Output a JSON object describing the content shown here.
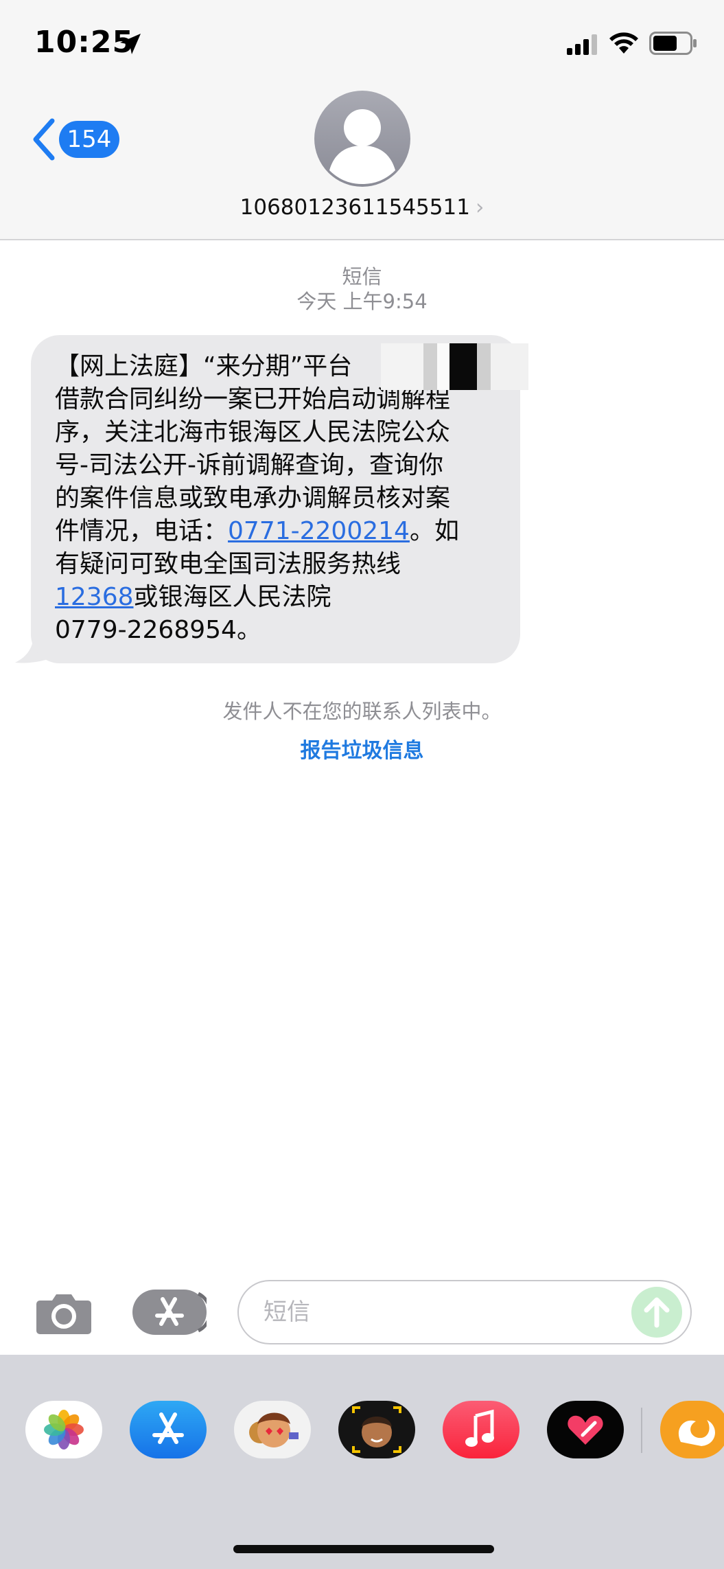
{
  "status_bar": {
    "time": "10:25",
    "location_icon": "location-arrow-icon",
    "signal_icon": "cellular-signal-icon",
    "wifi_icon": "wifi-icon",
    "battery_icon": "battery-icon"
  },
  "header": {
    "back_icon": "chevron-left-icon",
    "unread_count": "154",
    "avatar_icon": "person-icon",
    "contact_number": "10680123611545511",
    "contact_chevron": "›"
  },
  "conversation": {
    "service_label": "短信",
    "timestamp": "今天 上午9:54",
    "message": {
      "line1": "【网上法庭】“来分期”平台",
      "line2": "借款合同纠纷一案已开始启动调解程",
      "line3": "序，关注北海市银海区人民法院公众",
      "line4": "号-司法公开-诉前调解查询，查询你",
      "line5": "的案件信息或致电承办调解员核对案",
      "line6_prefix": "件情况，电话：",
      "phone_link": "0771-2200214",
      "line6_suffix": "。如",
      "line7": "有疑问可致电全国司法服务热线",
      "hotline_link": "12368",
      "line8_suffix": "或银海区人民法院",
      "line9": "0779-2268954。"
    },
    "not_in_contacts": "发件人不在您的联系人列表中。",
    "report_junk": "报告垃圾信息"
  },
  "input_bar": {
    "camera_icon": "camera-icon",
    "apps_icon": "app-store-icon",
    "placeholder": "短信",
    "send_icon": "arrow-up-icon"
  },
  "app_drawer": {
    "apps": [
      "photos-icon",
      "app-store-icon",
      "memoji-stickers-icon",
      "animoji-icon",
      "music-icon",
      "digital-touch-icon",
      "uc-browser-icon"
    ]
  },
  "colors": {
    "accent": "#1e7cf2",
    "bubble": "#e9e9eb",
    "drawer": "#d5d6dc"
  }
}
